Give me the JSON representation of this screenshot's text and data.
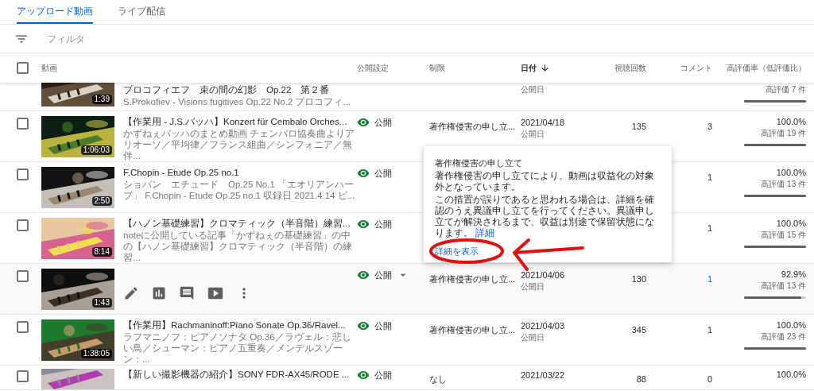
{
  "tabs": [
    {
      "label": "アップロード動画",
      "selected": true
    },
    {
      "label": "ライブ配信",
      "selected": false
    }
  ],
  "filter": {
    "placeholder": "フィルタ"
  },
  "header": {
    "checked": false,
    "columns": [
      {
        "label": "動画",
        "kind": "video",
        "sorted": false
      },
      {
        "label": "公開設定",
        "kind": "visibility",
        "sorted": false
      },
      {
        "label": "制限",
        "kind": "restriction",
        "sorted": false
      },
      {
        "label": "日付",
        "kind": "date",
        "sorted": true
      },
      {
        "label": "視聴回数",
        "kind": "views",
        "sorted": false
      },
      {
        "label": "コメント",
        "kind": "comments",
        "sorted": false
      },
      {
        "label": "高評価率（低評価比）",
        "kind": "rating",
        "sorted": false
      }
    ]
  },
  "rows": [
    {
      "kind": "partial",
      "duration": "1:39",
      "title": "プロコフィエフ　束の間の幻影　Op.22　第２番",
      "description": "S.Prokofiev - Visions fugitives Op.22 No.2 プロコフィ...",
      "date_label": "公開日",
      "likes": "高評価 7 件",
      "level": 1
    },
    {
      "kind": "video",
      "checked": false,
      "duration": "1:06:03",
      "title": "【作業用 - J.S.バッハ】Konzert für Cembalo Orches...",
      "description": "かずねぇバッハのまとめ動画 チェンバロ協奏曲よりアリオーソ／平均律／フランス組曲／シンフォニア／無伴...",
      "visibility": "公開",
      "restriction": "著作権侵害の申し立...",
      "date": "2021/04/18",
      "date_label": "公開日",
      "views": "135",
      "comments": "3",
      "comments_link": false,
      "rating": "100.0%",
      "likes": "高評価 19 件",
      "level": 1
    },
    {
      "kind": "video",
      "checked": false,
      "duration": "2:50",
      "title": "F.Chopin - Etude Op.25 no.1",
      "description": "ショパン　エチュード　Op.25 No.1 「エオリアンハープ」 F.Chopin - Etude Op.25 no.1 収録日 2021.4.14 ピ...",
      "visibility": "公開",
      "comments": "1",
      "comments_link": false,
      "rating": "100.0%",
      "likes": "高評価 13 件",
      "level": 1
    },
    {
      "kind": "video",
      "checked": false,
      "duration": "8:14",
      "title": "【ハノン基礎練習】クロマティック（半音階）練習...",
      "description": "noteに公開している記事「かずねぇの基礎練習」の中の【ハノン基礎練習】クロマティック（半音階）の練習...",
      "visibility": "公開",
      "comments": "1",
      "comments_link": false,
      "rating": "100.0%",
      "likes": "高評価 15 件",
      "level": 1
    },
    {
      "kind": "hover",
      "checked": false,
      "duration": "1:43",
      "visibility": "公開",
      "restriction": "著作権侵害の申し立...",
      "date": "2021/04/06",
      "date_label": "公開日",
      "views": "130",
      "comments": "1",
      "comments_link": true,
      "rating": "92.9%",
      "likes": "高評価 13 件",
      "level": 0.929
    },
    {
      "kind": "video",
      "checked": false,
      "duration": "1:38:05",
      "title": "【作業用】Rachmaninoff:Piano Sonate Op.36/Ravel...",
      "description": "ラフマニノフ：ピアノソナタ Op.36／ラヴェル：悲しい鳥／シューマン：ピアノ五重奏／メンデルスゾーン：...",
      "visibility": "公開",
      "restriction": "著作権侵害の申し立...",
      "date": "2021/04/03",
      "date_label": "公開日",
      "views": "345",
      "comments": "1",
      "comments_link": false,
      "rating": "100.0%",
      "likes": "高評価 23 件",
      "level": 1
    },
    {
      "kind": "cut",
      "checked": false,
      "title": "【新しい撮影機器の紹介】SONY FDR-AX45/RODE ...",
      "visibility": "公開",
      "restriction": "なし",
      "date": "2021/03/22",
      "views": "88",
      "comments": "0",
      "comments_link": false,
      "rating": "100.0%"
    }
  ],
  "popover": {
    "title": "著作権侵害の申し立て",
    "paragraphs": [
      {
        "text": "著作権侵害の申し立てにより、動画は収益化の対象外となっています。"
      },
      {
        "text": "この措置が誤りであると思われる場合は、詳細を確認のうえ異議申し立てを行ってください。異議申し立てが解決されるまで、収益は別途で保留状態になります。",
        "link": "詳細"
      }
    ],
    "more_link": "詳細を表示"
  }
}
